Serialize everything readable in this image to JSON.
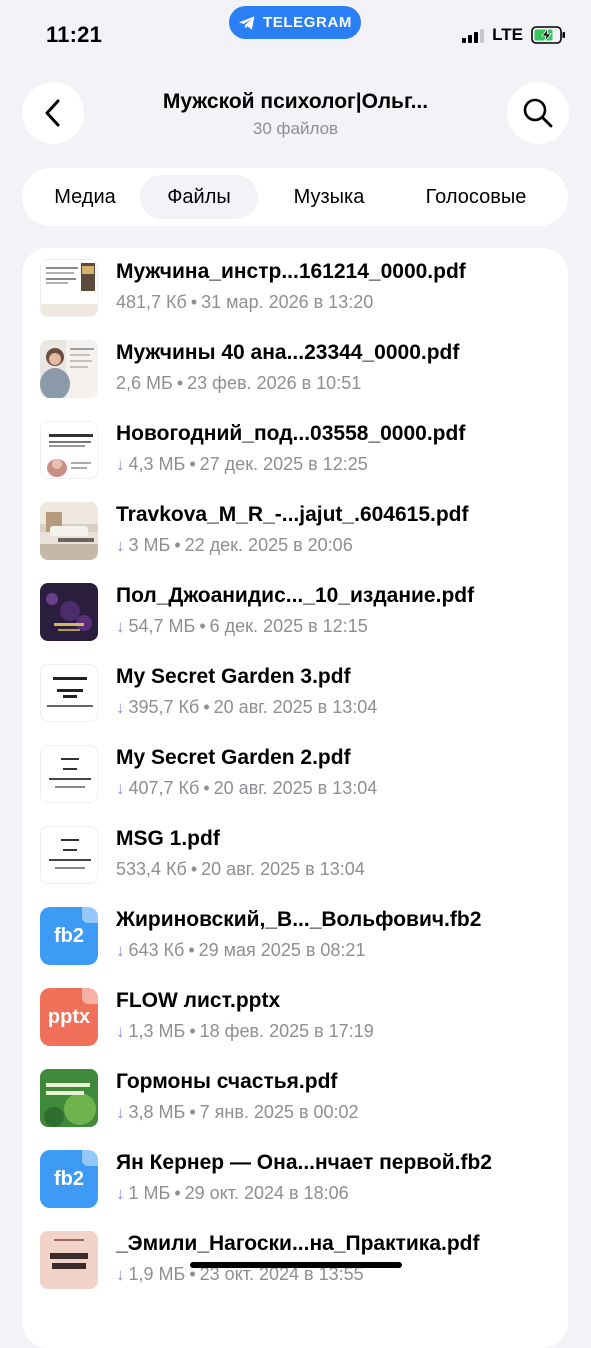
{
  "status": {
    "time": "11:21",
    "app_pill": "TELEGRAM",
    "network": "LTE"
  },
  "header": {
    "title": "Мужской психолог|Ольг...",
    "subtitle": "30 файлов"
  },
  "tabs": [
    {
      "label": "Медиа",
      "active": false
    },
    {
      "label": "Файлы",
      "active": true
    },
    {
      "label": "Музыка",
      "active": false
    },
    {
      "label": "Голосовые",
      "active": false
    }
  ],
  "files": [
    {
      "name": "Мужчина_инстр...161214_0000.pdf",
      "size": "481,7 Кб",
      "date": "31 мар. 2026 в 13:20",
      "download": false,
      "thumb": "doc-book"
    },
    {
      "name": "Мужчины 40  ана...23344_0000.pdf",
      "size": "2,6 МБ",
      "date": "23 фев. 2026 в 10:51",
      "download": false,
      "thumb": "photo-woman"
    },
    {
      "name": "Новогодний_под...03558_0000.pdf",
      "size": "4,3 МБ",
      "date": "27 дек. 2025 в 12:25",
      "download": true,
      "thumb": "doc-newyear"
    },
    {
      "name": "Travkova_M_R_-...jajut_.604615.pdf",
      "size": "3 МБ",
      "date": "22 дек. 2025 в 20:06",
      "download": true,
      "thumb": "photo-room"
    },
    {
      "name": "Пол_Джоанидис..._10_издание.pdf",
      "size": "54,7 МБ",
      "date": "6 дек. 2025 в 12:15",
      "download": true,
      "thumb": "dark-book"
    },
    {
      "name": "My Secret Garden 3.pdf",
      "size": "395,7 Кб",
      "date": "20 авг. 2025 в 13:04",
      "download": true,
      "thumb": "doc-text"
    },
    {
      "name": "My Secret Garden 2.pdf",
      "size": "407,7 Кб",
      "date": "20 авг. 2025 в 13:04",
      "download": true,
      "thumb": "doc-text"
    },
    {
      "name": "MSG 1.pdf",
      "size": "533,4 Кб",
      "date": "20 авг. 2025 в 13:04",
      "download": false,
      "thumb": "doc-text"
    },
    {
      "name": "Жириновский,_В..._Вольфович.fb2",
      "size": "643 Кб",
      "date": "29 мая 2025 в 08:21",
      "download": true,
      "thumb": "fb2"
    },
    {
      "name": "FLOW лист.pptx",
      "size": "1,3 МБ",
      "date": "18 фев. 2025 в 17:19",
      "download": true,
      "thumb": "pptx"
    },
    {
      "name": "Гормоны счастья.pdf",
      "size": "3,8 МБ",
      "date": "7 янв. 2025 в 00:02",
      "download": true,
      "thumb": "green-book"
    },
    {
      "name": "Ян Кернер — Она...нчает первой.fb2",
      "size": "1 МБ",
      "date": "29 окт. 2024 в 18:06",
      "download": true,
      "thumb": "fb2"
    },
    {
      "name": "_Эмили_Нагоски...на_Практика.pdf",
      "size": "1,9 МБ",
      "date": "23 окт. 2024 в 13:55",
      "download": true,
      "thumb": "pink-book"
    }
  ],
  "thumb_text": {
    "doc_text_author": "Нэнси Фрайдей",
    "doc_text_title": "Мой Тайный Сад",
    "fb2_label": "fb2",
    "pptx_label": "pptx",
    "newyear_text": "НОВОГОДНИЙ ПОДАРОК",
    "room_text": "НЕВЕРНОСТЬ",
    "green_text": "ГОРМОНЫ СЧАСТЬЯ",
    "pink_text": "КАК ХОЧЕТ",
    "woman_text": "Ольга Фадина"
  },
  "colors": {
    "accent": "#2a7ff5",
    "download_arrow": "#9f7fe0",
    "fb2": "#3d9bf5",
    "pptx": "#f0705a",
    "meta_gray": "#8e8e93"
  }
}
